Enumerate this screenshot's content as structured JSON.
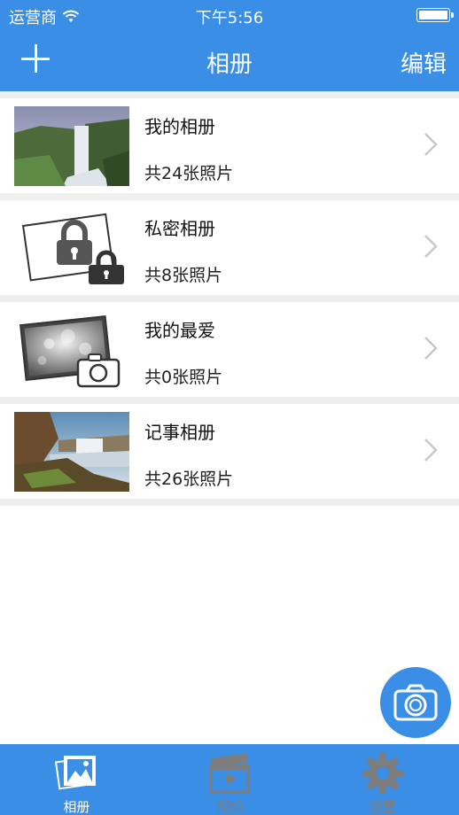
{
  "status_bar": {
    "carrier": "运营商",
    "time": "下午5:56"
  },
  "nav": {
    "title": "相册",
    "edit_label": "编辑"
  },
  "albums": [
    {
      "name": "我的相册",
      "count": "共24张照片",
      "thumb_icon": "waterfall-photo"
    },
    {
      "name": "私密相册",
      "count": "共8张照片",
      "thumb_icon": "lock-photo"
    },
    {
      "name": "我的最爱",
      "count": "共0张照片",
      "thumb_icon": "favorite-camera-photo"
    },
    {
      "name": "记事相册",
      "count": "共26张照片",
      "thumb_icon": "coast-waterfall-photo"
    }
  ],
  "tabs": [
    {
      "label": "相册",
      "icon": "photos-icon",
      "active": true
    },
    {
      "label": "视频",
      "icon": "clapperboard-icon",
      "active": false
    },
    {
      "label": "设置",
      "icon": "gear-icon",
      "active": false
    }
  ],
  "colors": {
    "primary": "#3a8ee6",
    "inactive_tab": "#7d7d7d",
    "separator": "#eeeeee"
  }
}
